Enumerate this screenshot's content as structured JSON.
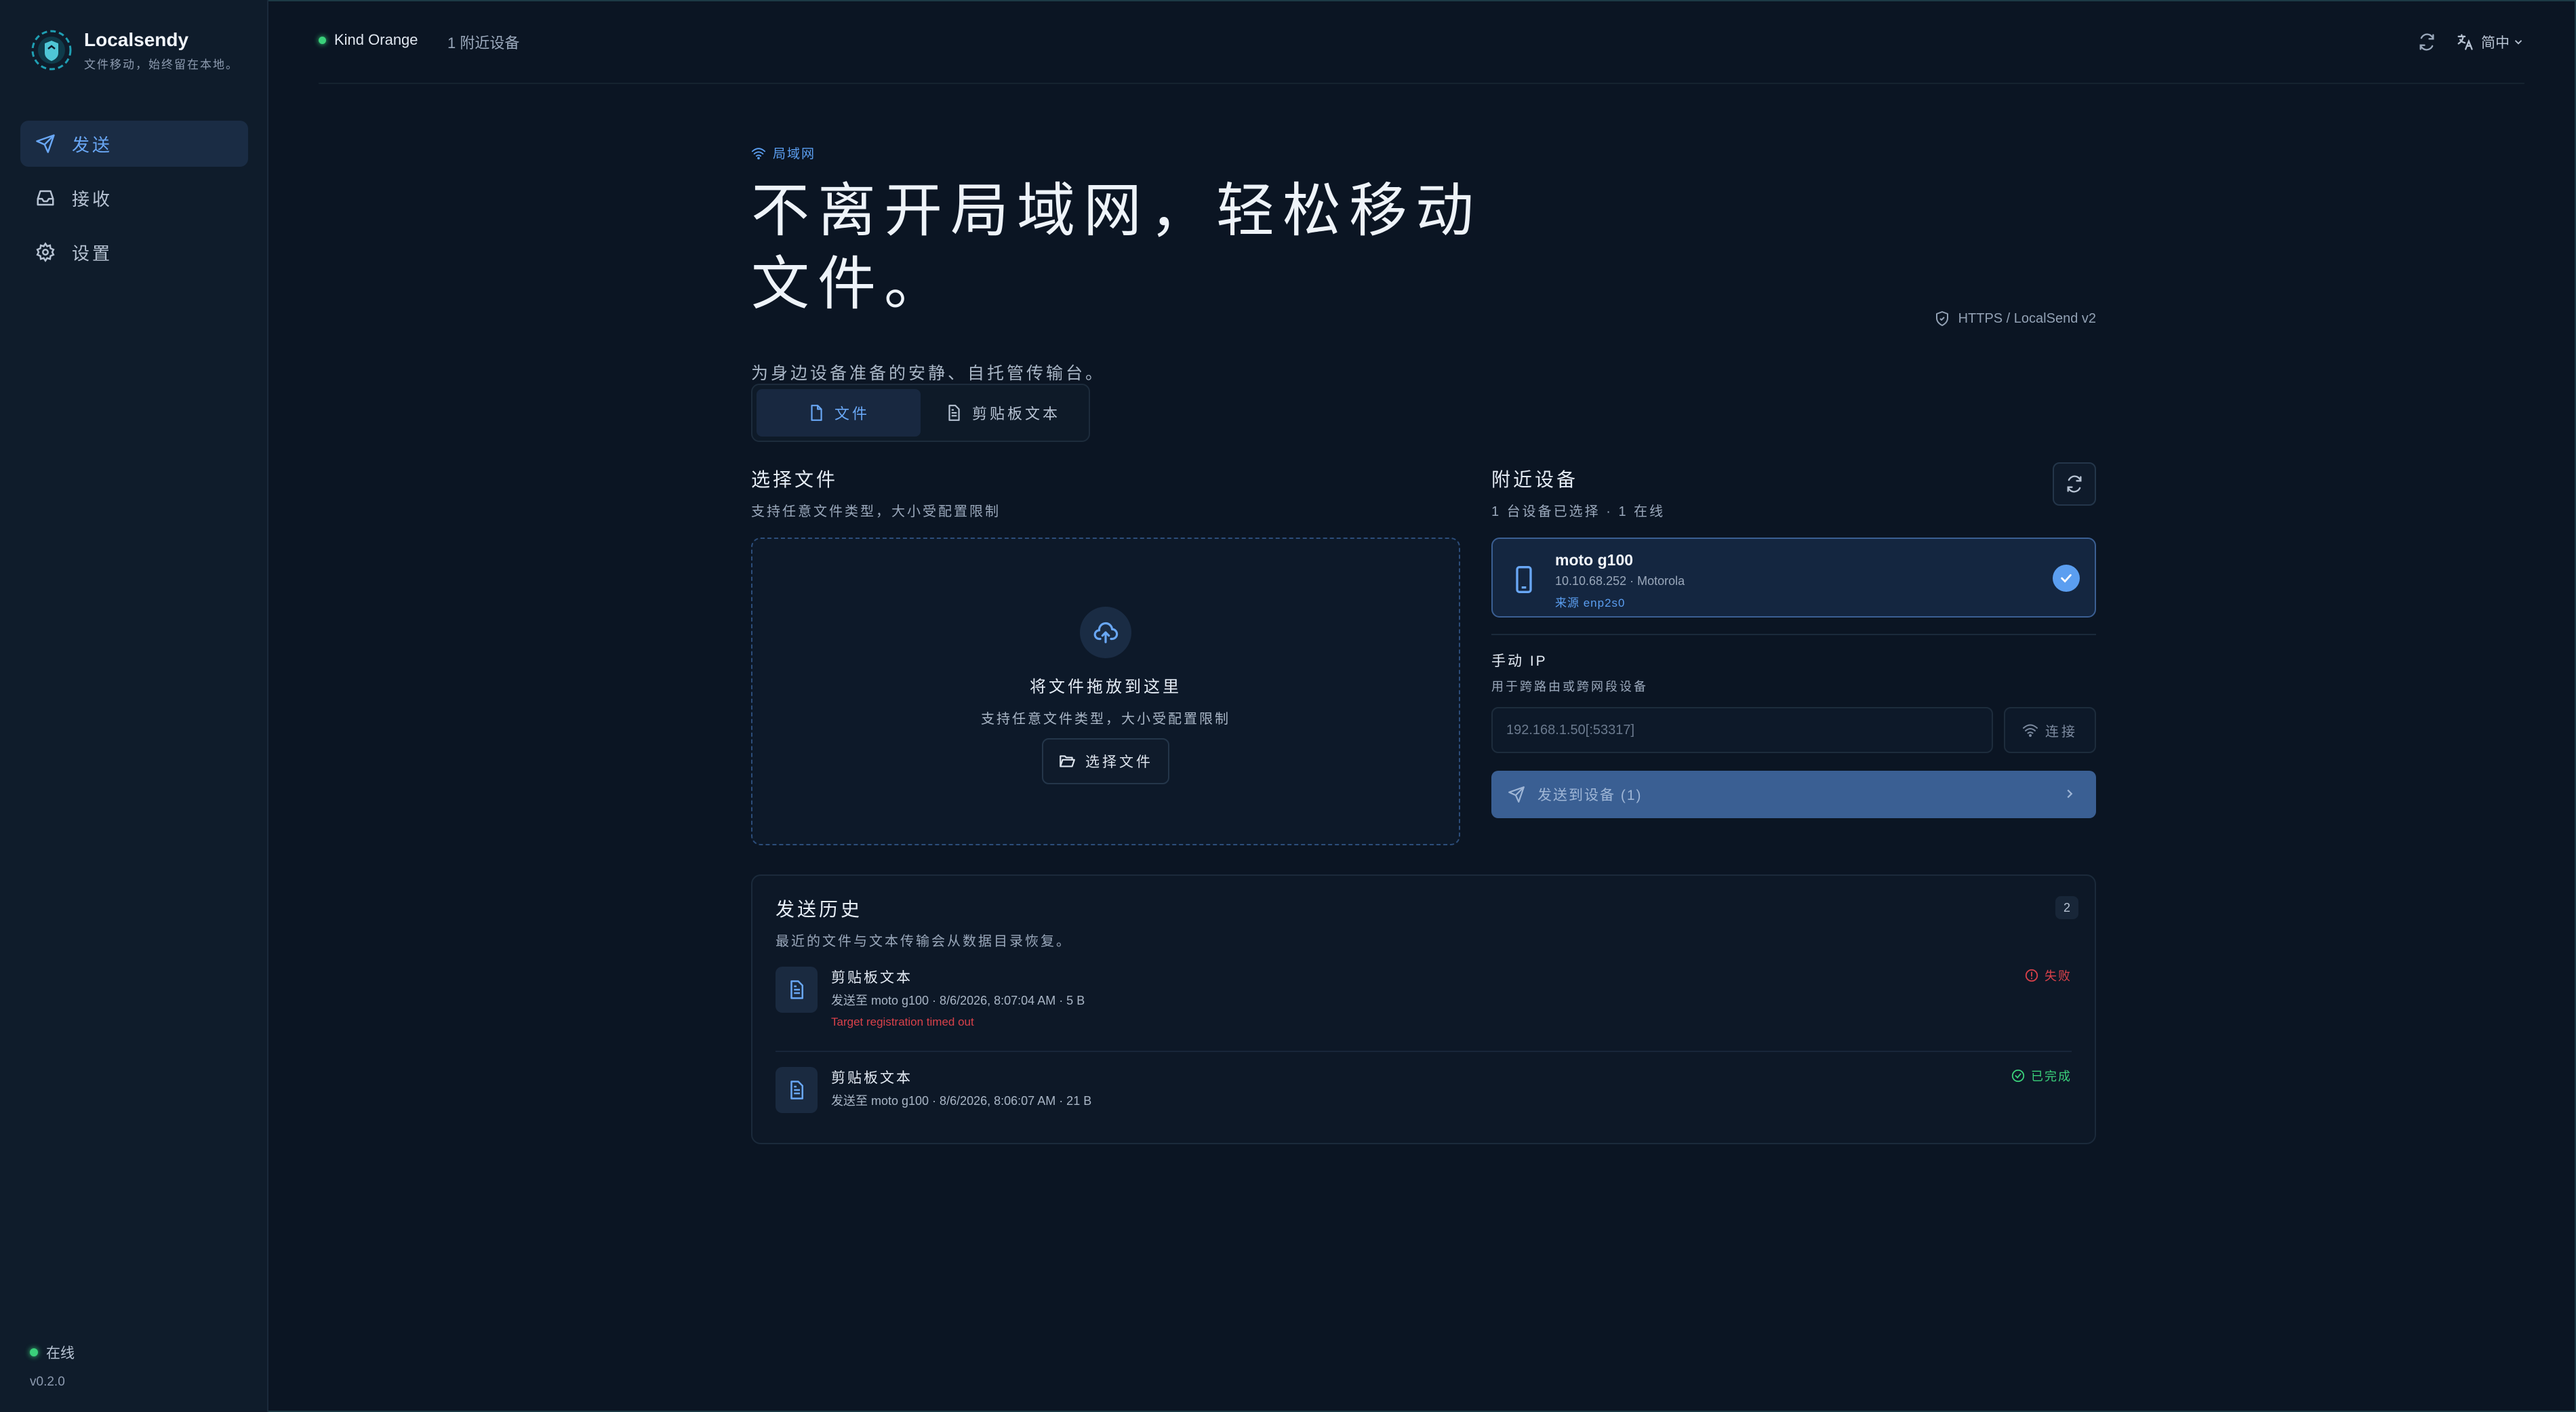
{
  "app": {
    "name": "Localsendy",
    "tagline": "文件移动，始终留在本地。",
    "version": "v0.2.0",
    "online_label": "在线"
  },
  "sidebar": {
    "items": [
      {
        "label": "发送",
        "icon": "send-icon",
        "active": true
      },
      {
        "label": "接收",
        "icon": "inbox-icon",
        "active": false
      },
      {
        "label": "设置",
        "icon": "gear-icon",
        "active": false
      }
    ]
  },
  "topbar": {
    "device_name": "Kind Orange",
    "nearby_count": "1 附近设备",
    "language": "简中"
  },
  "main": {
    "lan_tag": "局域网",
    "hero": "不离开局域网，轻松移动文件。",
    "subtitle": "为身边设备准备的安静、自托管传输台。",
    "protocol": "HTTPS / LocalSend v2",
    "tabs": [
      {
        "label": "文件",
        "icon": "file-icon",
        "active": true
      },
      {
        "label": "剪贴板文本",
        "icon": "clipboard-text-icon",
        "active": false
      }
    ]
  },
  "files": {
    "title": "选择文件",
    "subtitle": "支持任意文件类型，大小受配置限制",
    "drop_title": "将文件拖放到这里",
    "drop_subtitle": "支持任意文件类型，大小受配置限制",
    "choose_label": "选择文件"
  },
  "nearby": {
    "title": "附近设备",
    "subtitle": "1 台设备已选择 · 1 在线",
    "devices": [
      {
        "name": "moto g100",
        "meta": "10.10.68.252 · Motorola",
        "source": "来源 enp2s0",
        "selected": true
      }
    ],
    "manual_title": "手动 IP",
    "manual_subtitle": "用于跨路由或跨网段设备",
    "ip_placeholder": "192.168.1.50[:53317]",
    "connect_label": "连接",
    "send_label": "发送到设备 (1)"
  },
  "history": {
    "title": "发送历史",
    "subtitle": "最近的文件与文本传输会从数据目录恢复。",
    "count": "2",
    "rows": [
      {
        "title": "剪贴板文本",
        "meta": "发送至 moto g100 · 8/6/2026, 8:07:04 AM · 5 B",
        "error": "Target registration timed out",
        "status": "失败",
        "state": "failed"
      },
      {
        "title": "剪贴板文本",
        "meta": "发送至 moto g100 · 8/6/2026, 8:06:07 AM · 21 B",
        "error": "",
        "status": "已完成",
        "state": "done"
      }
    ]
  },
  "colors": {
    "background": "#0b1523",
    "sidebar": "#0f1c2b",
    "accent": "#5b9ef0",
    "success": "#3ad07a",
    "danger": "#d9414a"
  }
}
